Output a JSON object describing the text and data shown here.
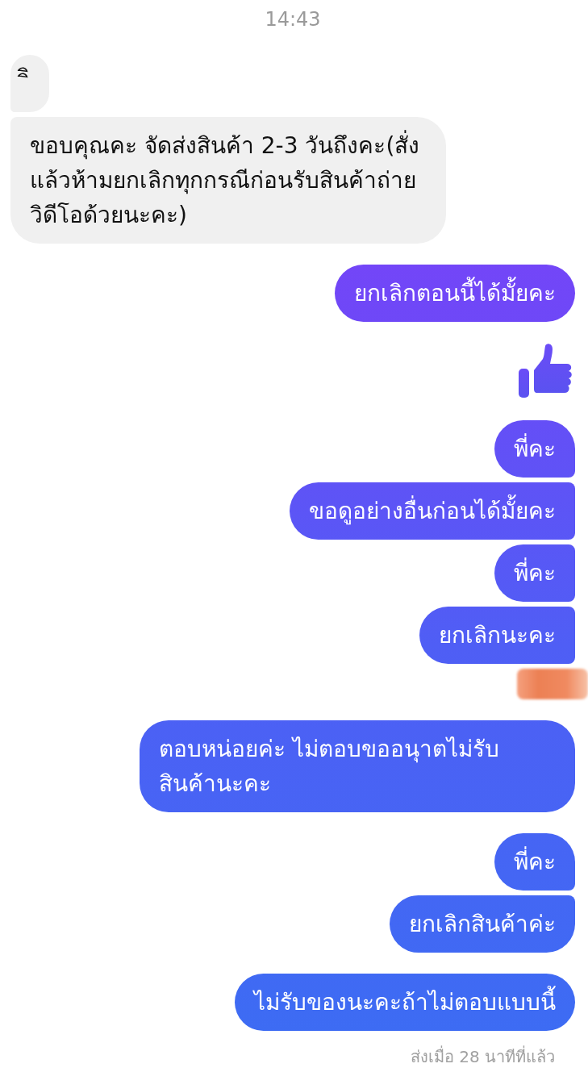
{
  "timestamp": "14:43",
  "groups": [
    {
      "outgoing": false,
      "items": [
        {
          "kind": "text",
          "text": "ิิ"
        },
        {
          "kind": "text",
          "text": "ขอบคุณคะ จัดส่งสินค้า 2-3 วันถึงคะ(สั่งแล้วห้ามยกเลิกทุกกรณีก่อนรับสินค้าถ่ายวิดีโอด้วยนะคะ)"
        }
      ]
    },
    {
      "outgoing": true,
      "items": [
        {
          "kind": "text",
          "text": "ยกเลิกตอนนี้ได้มั้ยคะ"
        }
      ]
    },
    {
      "outgoing": true,
      "items": [
        {
          "kind": "like"
        }
      ]
    },
    {
      "outgoing": true,
      "items": [
        {
          "kind": "text",
          "text": "พี่คะ"
        },
        {
          "kind": "text",
          "text": "ขอดูอย่างอื่นก่อนได้มั้ยคะ"
        },
        {
          "kind": "text",
          "text": "พี่คะ"
        },
        {
          "kind": "text",
          "text": "ยกเลิกนะคะ"
        },
        {
          "kind": "redacted"
        }
      ]
    },
    {
      "outgoing": true,
      "items": [
        {
          "kind": "text",
          "text": "ตอบหน่อยค่ะ ไม่ตอบขออนุาตไม่รับสินค้านะคะ"
        }
      ]
    },
    {
      "outgoing": true,
      "items": [
        {
          "kind": "text",
          "text": "พี่คะ"
        },
        {
          "kind": "text",
          "text": "ยกเลิกสินค้าค่ะ"
        }
      ]
    },
    {
      "outgoing": true,
      "items": [
        {
          "kind": "text",
          "text": "ไม่รับของนะคะถ้าไม่ตอบแบบนี้"
        }
      ]
    }
  ],
  "status": "ส่งเมื่อ 28 นาทีที่แล้ว"
}
